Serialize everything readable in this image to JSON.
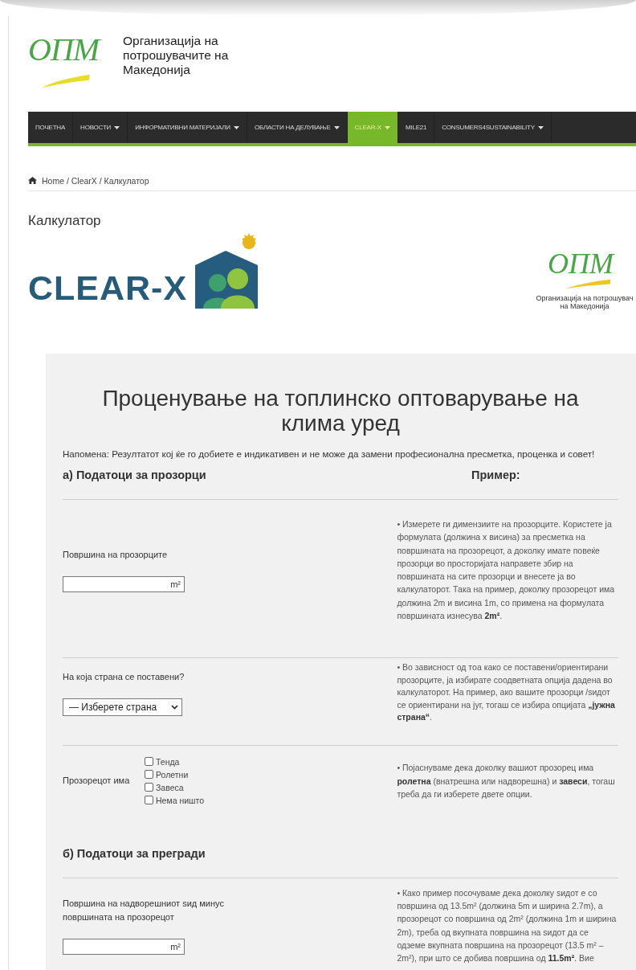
{
  "header": {
    "logo_mark": "ОПМ",
    "org_name": [
      "Организација на",
      "потрошувачите на",
      "Македонија"
    ]
  },
  "nav": [
    {
      "label": "ПОЧЕТНА",
      "caret": false,
      "selected": false
    },
    {
      "label": "НОВОСТИ",
      "caret": true,
      "selected": false
    },
    {
      "label": "ИНФОРМАТИВНИ МАТЕРИЈАЛИ",
      "caret": true,
      "selected": false
    },
    {
      "label": "ОБЛАСТИ НА ДЕЛУВАЊЕ",
      "caret": true,
      "selected": false
    },
    {
      "label": "CLEAR-X",
      "caret": true,
      "selected": true
    },
    {
      "label": "MILE21",
      "caret": false,
      "selected": false
    },
    {
      "label": "CONSUMERS4SUSTAINABILITY",
      "caret": true,
      "selected": false
    }
  ],
  "breadcrumb": "Home / ClearX / Калкулатор",
  "page_title": "Калкулатор",
  "logos": {
    "clearx": "CLEAR-X",
    "partner_mark": "ОПМ",
    "partner_name": [
      "Организација на потрошувач",
      "на Македонија"
    ]
  },
  "calculator": {
    "title": "Проценување на топлинско оптоварување на клима уред",
    "note": "Напомена: Резултатот кој ќе го добиете е индикативен и не може да замени професионална пресметка, проценка и совет!",
    "sections": [
      {
        "heading": "а) Податоци за прозорци",
        "example_heading": "Пример:",
        "rows": [
          {
            "kind": "input",
            "label": "Површина на прозорците",
            "unit": "m²",
            "example": "• Измерете ги димензиите на прозорците. Користете ја формулата (должина x висина) за пресметка на површината на прозорецот, а доколку имате повеќе прозорци во просторијата направете збир на површината на сите прозорци и внесете ја во калкулаторот. Така на пример, доколку прозорецот има должина 2m и висина 1m, со примена на формулата површината изнесува **2m²**."
          },
          {
            "kind": "select",
            "label": "На која страна се поставени?",
            "value": "— Изберете страна",
            "example": "• Во зависност од тоа како се поставени/ориентирани прозорците, ја избирате соодветната опција дадена во калкулаторот. На пример, ако вашите прозорци /ѕидот се ориентирани на југ, тогаш се избира опцијата **„јужна страна“**."
          },
          {
            "kind": "checkboxes",
            "label": "Прозорецот има",
            "options": [
              {
                "label": "Тенда",
                "checked": false
              },
              {
                "label": "Ролетни",
                "checked": false
              },
              {
                "label": "Завеса",
                "checked": false
              },
              {
                "label": "Нема ништо",
                "checked": false
              }
            ],
            "example": "• Појаснуваме дека доколку вашиот прозорец има **ролетна** (внатрешна или надворешна) и **завеси**, тогаш треба да ги изберете двете опции."
          }
        ]
      },
      {
        "heading": "б) Податоци за прегради",
        "rows": [
          {
            "kind": "input",
            "label": "Површина на надворешниот ѕид минус површината на прозорецот",
            "unit": "m²",
            "example": "• Како пример посочуваме дека доколку ѕидот е со површина од 13.5m² (должина 5m и ширина 2.7m), а прозорецот со површина од 2m² (должина 1m и ширина 2m), треба од вкупната површина на ѕидот да се одземе вкупната површина на прозорецот (13.5 m² – 2m²), при што се добива површина од **11.5m²**. Вие"
          }
        ]
      }
    ]
  }
}
